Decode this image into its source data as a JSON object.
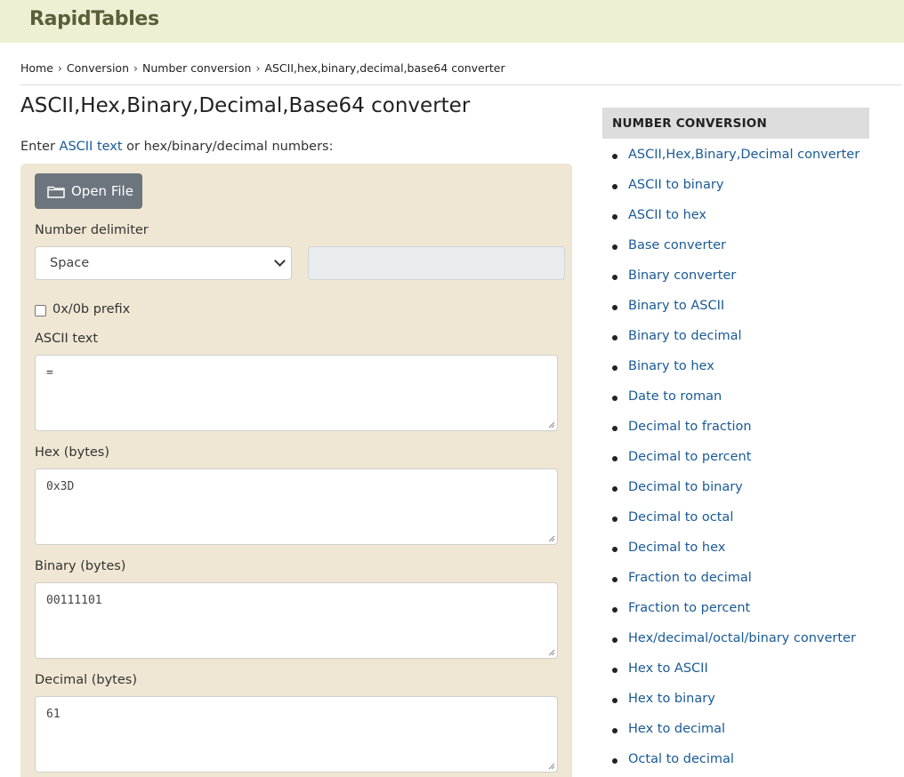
{
  "header": {
    "logo": "RapidTables"
  },
  "breadcrumb": {
    "items": [
      "Home",
      "Conversion",
      "Number conversion",
      "ASCII,hex,binary,decimal,base64 converter"
    ],
    "separator": "›"
  },
  "page": {
    "title": "ASCII,Hex,Binary,Decimal,Base64 converter",
    "intro_before": "Enter ",
    "intro_link": "ASCII text",
    "intro_after": " or hex/binary/decimal numbers:"
  },
  "form": {
    "open_file_label": "Open File",
    "delimiter_label": "Number delimiter",
    "delimiter_value": "Space",
    "prefix_label": "0x/0b prefix",
    "prefix_checked": false,
    "ascii_label": "ASCII text",
    "ascii_value": "=",
    "hex_label": "Hex (bytes)",
    "hex_value": "0x3D",
    "binary_label": "Binary (bytes)",
    "binary_value": "00111101",
    "decimal_label": "Decimal (bytes)",
    "decimal_value": "61"
  },
  "sidebar": {
    "heading": "NUMBER CONVERSION",
    "items": [
      "ASCII,Hex,Binary,Decimal converter",
      "ASCII to binary",
      "ASCII to hex",
      "Base converter",
      "Binary converter",
      "Binary to ASCII",
      "Binary to decimal",
      "Binary to hex",
      "Date to roman",
      "Decimal to fraction",
      "Decimal to percent",
      "Decimal to binary",
      "Decimal to octal",
      "Decimal to hex",
      "Fraction to decimal",
      "Fraction to percent",
      "Hex/decimal/octal/binary converter",
      "Hex to ASCII",
      "Hex to binary",
      "Hex to decimal",
      "Octal to decimal"
    ]
  },
  "colors": {
    "header_bg": "#efefd4",
    "panel_bg": "#efe7d3",
    "link": "#1a5a96",
    "button_bg": "#6c757d"
  }
}
